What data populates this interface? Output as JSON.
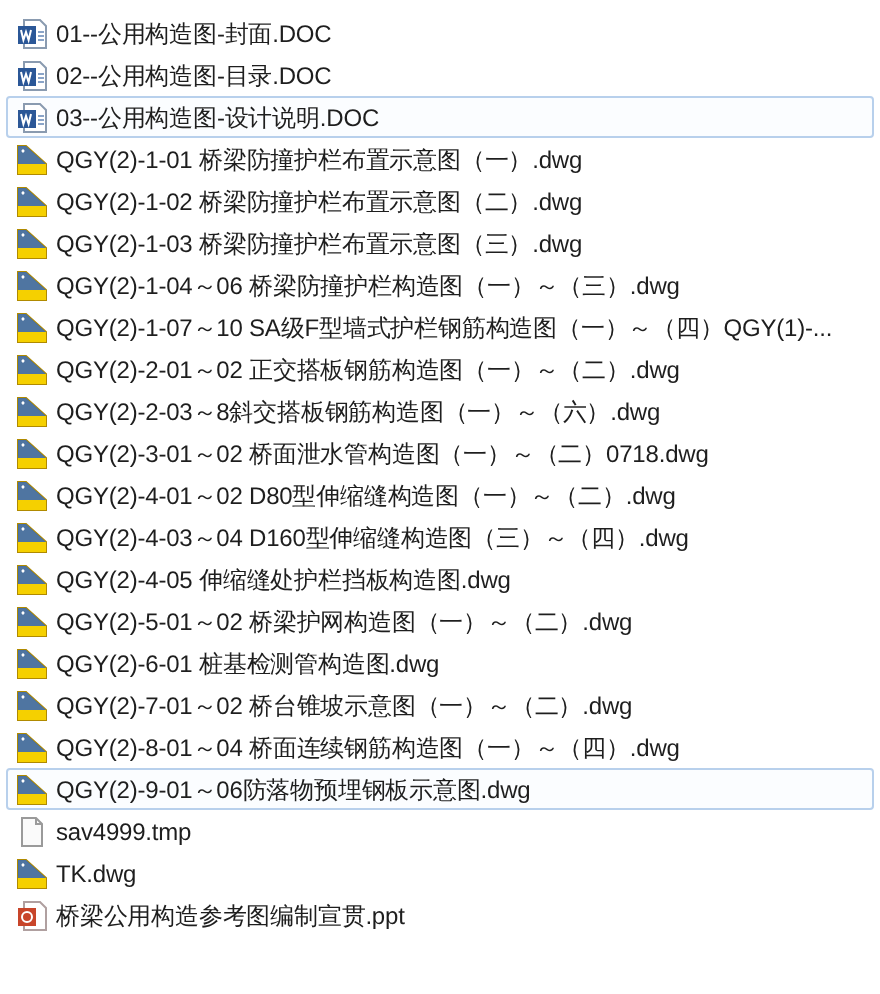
{
  "files": [
    {
      "name": "01--公用构造图-封面.DOC",
      "kind": "word",
      "selected": false
    },
    {
      "name": "02--公用构造图-目录.DOC",
      "kind": "word",
      "selected": false
    },
    {
      "name": "03--公用构造图-设计说明.DOC",
      "kind": "word",
      "selected": true
    },
    {
      "name": "QGY(2)-1-01 桥梁防撞护栏布置示意图（一）.dwg",
      "kind": "dwg",
      "selected": false
    },
    {
      "name": "QGY(2)-1-02 桥梁防撞护栏布置示意图（二）.dwg",
      "kind": "dwg",
      "selected": false
    },
    {
      "name": "QGY(2)-1-03 桥梁防撞护栏布置示意图（三）.dwg",
      "kind": "dwg",
      "selected": false
    },
    {
      "name": "QGY(2)-1-04～06 桥梁防撞护栏构造图（一）～（三）.dwg",
      "kind": "dwg",
      "selected": false
    },
    {
      "name": "QGY(2)-1-07～10 SA级F型墙式护栏钢筋构造图（一）～（四）QGY(1)-...",
      "kind": "dwg",
      "selected": false
    },
    {
      "name": "QGY(2)-2-01～02 正交搭板钢筋构造图（一）～（二）.dwg",
      "kind": "dwg",
      "selected": false
    },
    {
      "name": "QGY(2)-2-03～8斜交搭板钢筋构造图（一）～（六）.dwg",
      "kind": "dwg",
      "selected": false
    },
    {
      "name": "QGY(2)-3-01～02 桥面泄水管构造图（一）～（二）0718.dwg",
      "kind": "dwg",
      "selected": false
    },
    {
      "name": "QGY(2)-4-01～02 D80型伸缩缝构造图（一）～（二）.dwg",
      "kind": "dwg",
      "selected": false
    },
    {
      "name": "QGY(2)-4-03～04 D160型伸缩缝构造图（三）～（四）.dwg",
      "kind": "dwg",
      "selected": false
    },
    {
      "name": "QGY(2)-4-05 伸缩缝处护栏挡板构造图.dwg",
      "kind": "dwg",
      "selected": false
    },
    {
      "name": "QGY(2)-5-01～02 桥梁护网构造图（一）～（二）.dwg",
      "kind": "dwg",
      "selected": false
    },
    {
      "name": "QGY(2)-6-01 桩基检测管构造图.dwg",
      "kind": "dwg",
      "selected": false
    },
    {
      "name": "QGY(2)-7-01～02 桥台锥坡示意图（一）～（二）.dwg",
      "kind": "dwg",
      "selected": false
    },
    {
      "name": "QGY(2)-8-01～04 桥面连续钢筋构造图（一）～（四）.dwg",
      "kind": "dwg",
      "selected": false
    },
    {
      "name": "QGY(2)-9-01～06防落物预埋钢板示意图.dwg",
      "kind": "dwg",
      "selected": true
    },
    {
      "name": "sav4999.tmp",
      "kind": "tmp",
      "selected": false
    },
    {
      "name": "TK.dwg",
      "kind": "dwg",
      "selected": false
    },
    {
      "name": "桥梁公用构造参考图编制宣贯.ppt",
      "kind": "ppt",
      "selected": false
    }
  ]
}
